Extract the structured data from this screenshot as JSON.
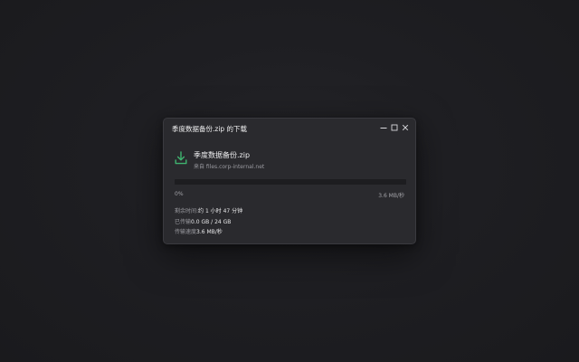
{
  "window": {
    "title": "季度数据备份.zip 的下载"
  },
  "icons": {
    "minimize": "minimize-icon",
    "maximize": "maximize-icon",
    "close": "close-icon",
    "download": "download-icon"
  },
  "file": {
    "name": "季度数据备份.zip",
    "source": "来自 files.corp-internal.net"
  },
  "progress": {
    "percent_label": "0%",
    "fraction": 0.0,
    "speed_label": "3.6 MB/秒"
  },
  "stats": {
    "remaining_label": "剩余时间:",
    "remaining_value": "约 1 小时 47 分钟",
    "transferred_label": "已传输",
    "transferred_value": "0.0 GB / 24 GB",
    "speed_label": "传输速度",
    "speed_value": "3.6 MB/秒"
  },
  "colors": {
    "accent": "#3fb36f",
    "background": "#1e1e22",
    "dialog": "#2a2a2e"
  }
}
